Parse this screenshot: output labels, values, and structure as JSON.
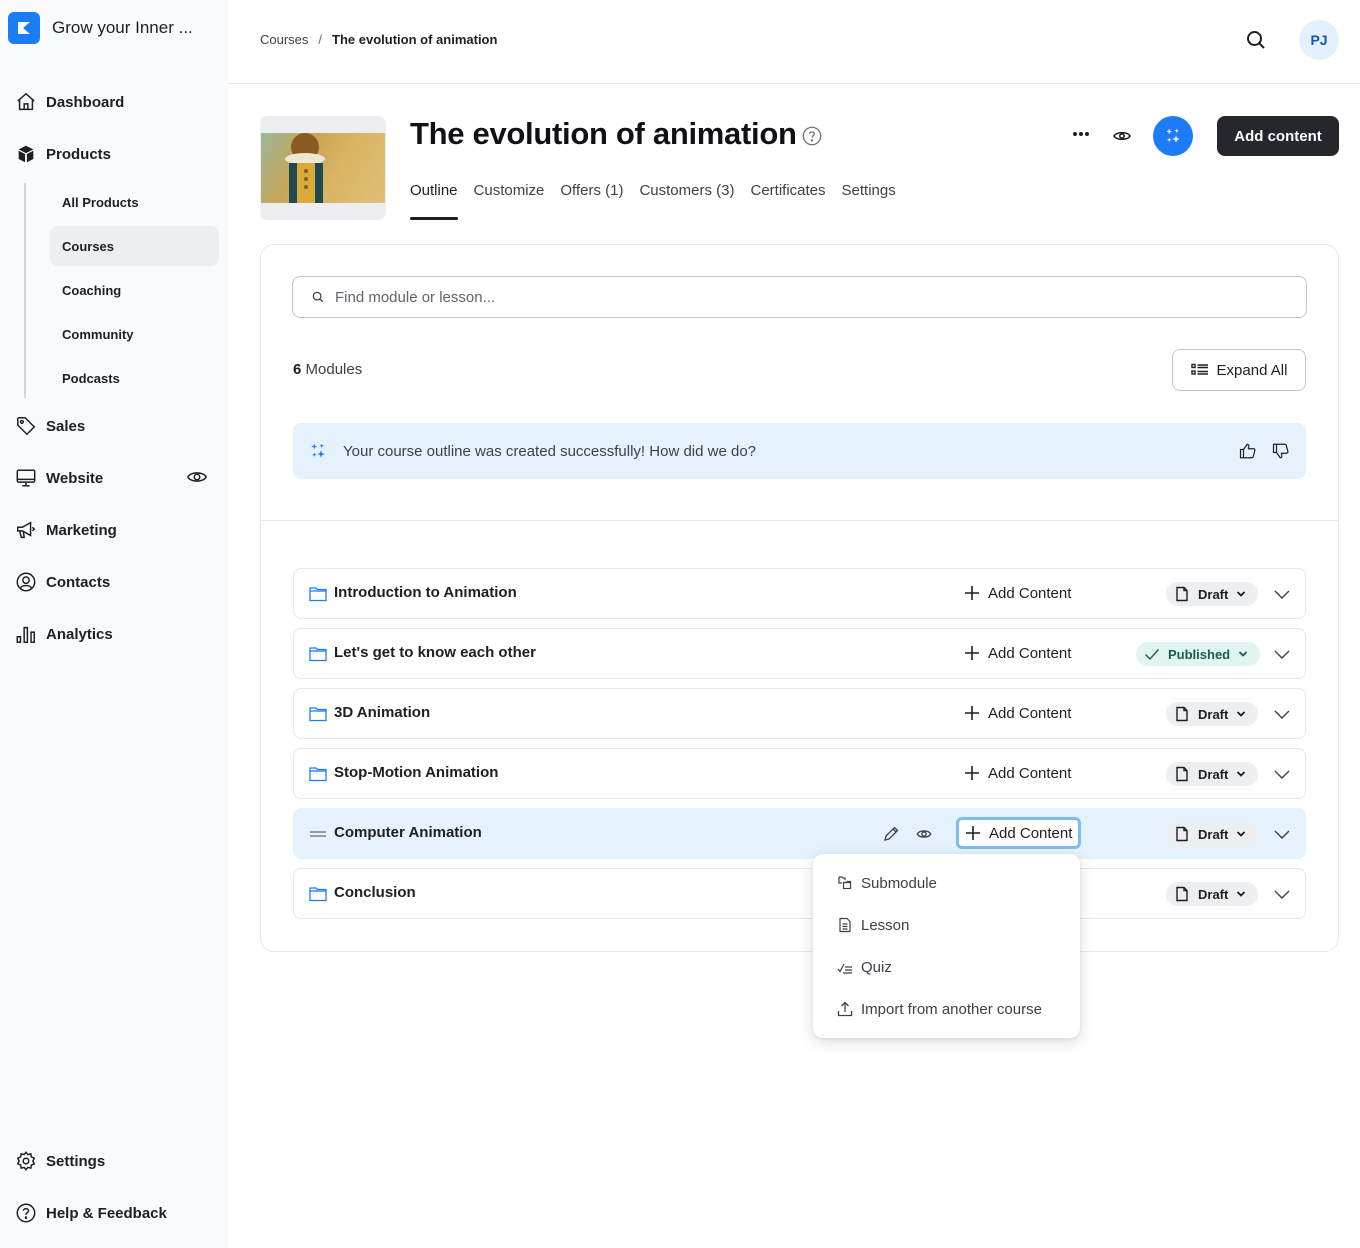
{
  "brand": {
    "name": "Grow your Inner ...",
    "accent": "#1c7bf6"
  },
  "sidebar": {
    "items": [
      {
        "label": "Dashboard",
        "icon": "home-icon"
      },
      {
        "label": "Products",
        "icon": "box-icon"
      },
      {
        "label": "Sales",
        "icon": "tag-icon"
      },
      {
        "label": "Website",
        "icon": "monitor-icon"
      },
      {
        "label": "Marketing",
        "icon": "megaphone-icon"
      },
      {
        "label": "Contacts",
        "icon": "user-circle-icon"
      },
      {
        "label": "Analytics",
        "icon": "bar-chart-icon"
      }
    ],
    "sub_items": [
      {
        "label": "All Products"
      },
      {
        "label": "Courses",
        "active": true
      },
      {
        "label": "Coaching"
      },
      {
        "label": "Community"
      },
      {
        "label": "Podcasts"
      }
    ],
    "bottom_items": [
      {
        "label": "Settings",
        "icon": "gear-icon"
      },
      {
        "label": "Help & Feedback",
        "icon": "help-circle-icon"
      }
    ]
  },
  "header": {
    "breadcrumb": {
      "parent": "Courses",
      "separator": "/",
      "current": "The evolution of animation"
    },
    "avatar_initials": "PJ"
  },
  "product": {
    "title": "The evolution of animation",
    "add_content_label": "Add content",
    "tabs": [
      {
        "label": "Outline",
        "active": true
      },
      {
        "label": "Customize"
      },
      {
        "label": "Offers (1)"
      },
      {
        "label": "Customers (3)"
      },
      {
        "label": "Certificates"
      },
      {
        "label": "Settings"
      }
    ]
  },
  "outline": {
    "search_placeholder": "Find module or lesson...",
    "module_count": "6",
    "module_count_label": " Modules",
    "expand_all_label": "Expand All",
    "banner_text": "Your course outline was created successfully! How did we do?",
    "add_content_label": "Add Content",
    "modules": [
      {
        "title": "Introduction to Animation",
        "status": "Draft"
      },
      {
        "title": "Let's get to know each other",
        "status": "Published"
      },
      {
        "title": "3D Animation",
        "status": "Draft"
      },
      {
        "title": "Stop-Motion Animation",
        "status": "Draft"
      },
      {
        "title": "Computer Animation",
        "status": "Draft",
        "hovered": true
      },
      {
        "title": "Conclusion",
        "status": "Draft"
      }
    ],
    "add_menu": [
      {
        "label": "Submodule",
        "icon": "submodule-icon"
      },
      {
        "label": "Lesson",
        "icon": "document-icon"
      },
      {
        "label": "Quiz",
        "icon": "checklist-icon"
      },
      {
        "label": "Import from another course",
        "icon": "upload-icon"
      }
    ]
  }
}
